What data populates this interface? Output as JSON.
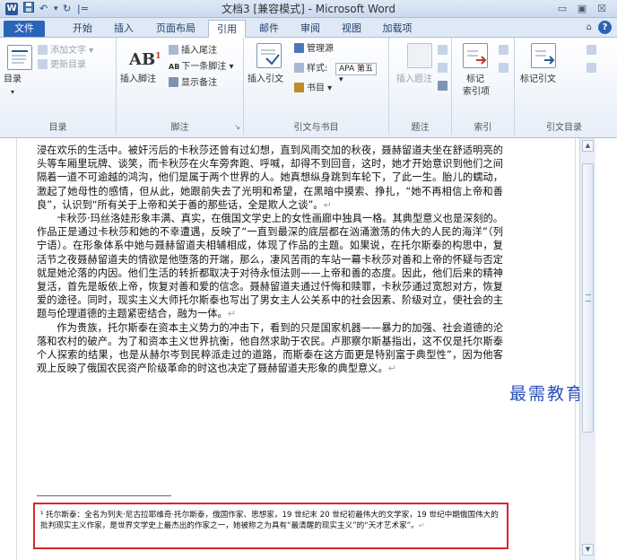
{
  "titlebar": {
    "title": "文档3 [兼容模式] - Microsoft Word",
    "logo": "W",
    "save_icon": "save-icon",
    "undo_icon": "↶",
    "redo_icon": "↻",
    "qa_sep": "|=",
    "minimize": "▭",
    "maximize": "▣",
    "close": "☒"
  },
  "tabs": {
    "file": "文件",
    "items": [
      "开始",
      "插入",
      "页面布局",
      "引用",
      "邮件",
      "审阅",
      "视图",
      "加载项"
    ],
    "active": "引用",
    "collapse": "⌂",
    "help": "?"
  },
  "ribbon": {
    "toc": {
      "toc_label": "目录",
      "add_text": "添加文字 ▾",
      "update_toc": "更新目录",
      "group_label": "目录"
    },
    "footnotes": {
      "insert_footnote": "插入脚注",
      "ab_glyph": "AB",
      "sup": "1",
      "insert_endnote": "插入尾注",
      "next_footnote": "下一条脚注 ▾",
      "show_notes": "显示备注",
      "next_glyph": "AB",
      "group_label": "脚注"
    },
    "citations": {
      "insert_citation": "插入引文",
      "manage_sources": "管理源",
      "style_label": "样式:",
      "style_value": "APA 第五 ▾",
      "bibliography": "书目 ▾",
      "group_label": "引文与书目"
    },
    "captions": {
      "insert_caption": "插入题注",
      "group_label": "题注"
    },
    "index": {
      "mark_entry": "标记",
      "mark_entry2": "索引项",
      "group_label": "索引"
    },
    "toa": {
      "mark_citation": "标记引文",
      "group_label": "引文目录"
    }
  },
  "document": {
    "paragraphs": [
      "浸在欢乐的生活中。被奸污后的卡秋莎还曾有过幻想，直到风雨交加的秋夜，聂赫留道夫坐在舒适明亮的头等车厢里玩牌、谈笑，而卡秋莎在火车旁奔跑、呼喊，却得不到回音，这时，她才开始意识到他们之间隔着一道不可逾越的鸿沟，他们是属于两个世界的人。她真想纵身跳到车轮下，了此一生。胎儿的蠕动，激起了她母性的感情，但从此，她跟前失去了光明和希望，在黑暗中摸索、挣扎，“她不再相信上帝和善良”，认识到“所有关于上帝和关于善的那些话，全是欺人之谈”。",
      "卡秋莎·玛丝洛娃形象丰满、真实，在俄国文学史上的女性画廊中独具一格。其典型意义也是深刻的。作品正是通过卡秋莎和她的不幸遭遇，反映了“一直到最深的底层都在汹涌激荡的伟大的人民的海洋”（列宁语）。在形象体系中她与聂赫留道夫相辅相成，体现了作品的主题。如果说，在托尔斯泰的构思中，复活节之夜聂赫留道夫的情欲是他堕落的开端，那么，凄风苦雨的车站一幕卡秋莎对善和上帝的怀疑与否定就是她沦落的内因。他们生活的转折都取决于对待永恒法则——上帝和善的态度。因此，他们后来的精神复活，首先是皈依上帝，恢复对善和爱的信念。聂赫留道夫通过忏悔和赎罪，卡秋莎通过宽恕对方，恢复爱的途径。同时，现实主义大师托尔斯泰也写出了男女主人公关系中的社会因素、阶级对立，使社会的主题与伦理道德的主题紧密结合，融为一体。",
      "作为贵族，托尔斯泰在资本主义势力的冲击下，看到的只是国家机器——暴力的加强、社会道德的沦落和农村的破产。为了和资本主义世界抗衡，他自然求助于农民。卢那察尔斯基指出，这不仅是托尔斯泰个人探索的结果，也是从赫尔岑到民粹派走过的道路，而斯泰在这方面更是特别富于典型性”，因为他客观上反映了俄国农民资产阶级革命的时这也决定了聂赫留道夫形象的典型意义。"
    ],
    "return_mark": "↵",
    "footnote": "¹ 托尔斯泰：全名为列夫·尼古拉耶维奇·托尔斯泰，俄国作家、思想家，19 世纪末 20 世纪初最伟大的文学家，19 世纪中期俄国伟大的批判现实主义作家，是世界文学史上最杰出的作家之一，她被称之为具有“最清醒的现实主义”的“天才艺术家”。"
  },
  "watermark": "最需教育",
  "scrollbar": {
    "up": "▲",
    "down": "▼"
  },
  "colors": {
    "accent": "#2b579a",
    "file_tab": "#2b63b8",
    "highlight_box": "#d9262c",
    "watermark": "#2a52b8"
  }
}
